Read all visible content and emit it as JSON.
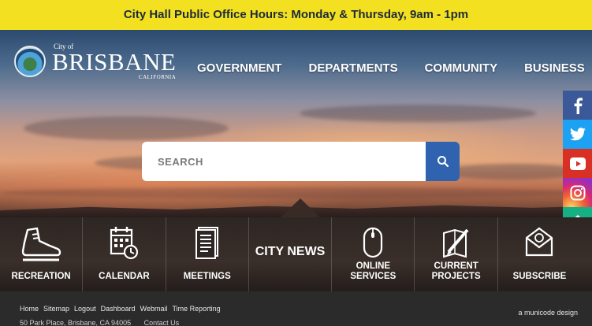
{
  "alert": {
    "text": "City Hall Public Office Hours: Monday & Thursday, 9am - 1pm"
  },
  "logo": {
    "small": "City of",
    "big": "BRISBANE",
    "sub": "CALIFORNIA"
  },
  "nav": {
    "items": [
      "GOVERNMENT",
      "DEPARTMENTS",
      "COMMUNITY",
      "BUSINESS"
    ]
  },
  "search": {
    "placeholder": "SEARCH"
  },
  "social": {
    "icons": [
      "facebook-icon",
      "twitter-icon",
      "youtube-icon",
      "instagram-icon",
      "home-icon"
    ]
  },
  "quicklinks": {
    "items": [
      {
        "label": "RECREATION",
        "icon": "shoe-icon"
      },
      {
        "label": "CALENDAR",
        "icon": "calendar-icon"
      },
      {
        "label": "MEETINGS",
        "icon": "document-icon"
      },
      {
        "label": "CITY NEWS",
        "icon": ""
      },
      {
        "label": "ONLINE SERVICES",
        "icon": "mouse-icon"
      },
      {
        "label": "CURRENT PROJECTS",
        "icon": "pencil-plan-icon"
      },
      {
        "label": "SUBSCRIBE",
        "icon": "envelope-icon"
      }
    ]
  },
  "footer": {
    "links": [
      "Home",
      "Sitemap",
      "Logout",
      "Dashboard",
      "Webmail",
      "Time Reporting"
    ],
    "address": "50 Park Place, Brisbane, CA 94005",
    "contact": "Contact Us",
    "credit": "a municode design"
  },
  "colors": {
    "alert_bg": "#f2e021",
    "search_button": "#2f63b0",
    "facebook": "#3b5998",
    "twitter": "#1da1f2",
    "youtube": "#d93025",
    "home": "#17b085"
  }
}
